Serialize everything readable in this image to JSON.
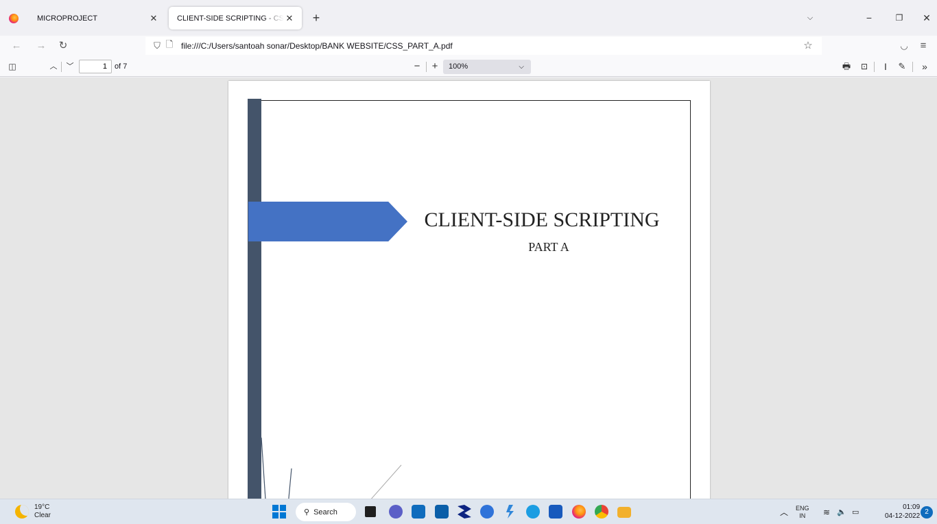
{
  "browser": {
    "tabs": [
      {
        "label": "MICROPROJECT",
        "active": false
      },
      {
        "label": "CLIENT-SIDE SCRIPTING - CSS_PART_A.pdf",
        "active": true
      }
    ],
    "new_tab_glyph": "+",
    "url": "file:///C:/Users/santoah sonar/Desktop/BANK WEBSITE/CSS_PART_A.pdf"
  },
  "pdf_toolbar": {
    "page_current": "1",
    "page_total_text": "of 7",
    "zoom_value": "100%"
  },
  "document": {
    "title": "CLIENT-SIDE SCRIPTING",
    "subtitle": "PART A",
    "colors": {
      "left_bar": "#44546a",
      "arrow": "#4472c4"
    }
  },
  "taskbar": {
    "weather_temp": "19°C",
    "weather_desc": "Clear",
    "search_label": "Search",
    "lang_top": "ENG",
    "lang_bottom": "IN",
    "time": "01:09",
    "date": "04-12-2022",
    "notification_count": "2"
  }
}
